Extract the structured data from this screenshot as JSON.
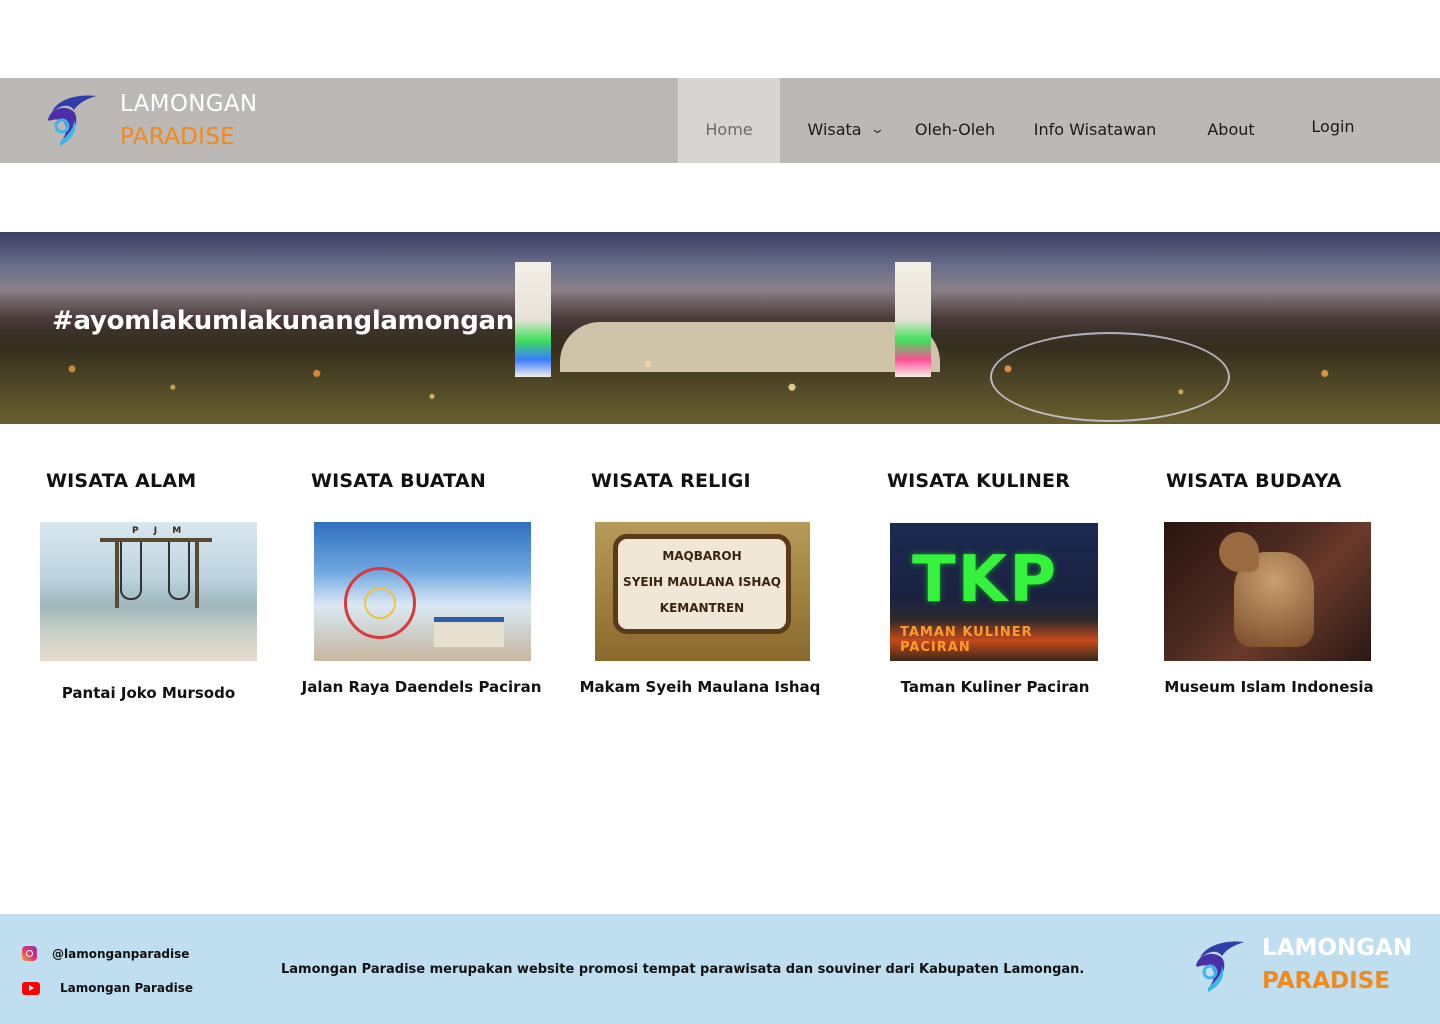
{
  "brand": {
    "line1": "LAMONGAN",
    "line2": "PARADISE"
  },
  "nav": {
    "home": "Home",
    "wisata": "Wisata",
    "oleh": "Oleh-Oleh",
    "info": "Info Wisatawan",
    "about": "About",
    "login": "Login"
  },
  "hero": {
    "tagline": "#ayomlakumlakunanglamongan"
  },
  "categories": [
    {
      "title": "WISATA ALAM",
      "caption": "Pantai Joko Mursodo"
    },
    {
      "title": "WISATA BUATAN",
      "caption": "Jalan Raya Daendels Paciran"
    },
    {
      "title": "WISATA RELIGI",
      "caption": "Makam Syeih Maulana Ishaq"
    },
    {
      "title": "WISATA KULINER",
      "caption": "Taman Kuliner Paciran"
    },
    {
      "title": "WISATA BUDAYA",
      "caption": "Museum Islam Indonesia"
    }
  ],
  "image_text": {
    "swing_sign": "P J M",
    "makam_line1": "MAQBAROH",
    "makam_line2": "SYEIH MAULANA ISHAQ",
    "makam_line3": "KEMANTREN",
    "tkp": "TKP",
    "tkp_sub": "TAMAN KULINER PACIRAN"
  },
  "footer": {
    "instagram": "@lamonganparadise",
    "youtube": "Lamongan Paradise",
    "description": "Lamongan Paradise merupakan website promosi tempat parawisata dan souviner dari Kabupaten Lamongan."
  },
  "colors": {
    "header_bg": "#bcb8b5",
    "accent_orange": "#f08a1c",
    "footer_bg": "#bfdff0",
    "logo_blue": "#2f3ea8",
    "logo_cyan": "#3fb6e8"
  },
  "icons": [
    "logo-fish-icon",
    "chevron-down-icon",
    "instagram-icon",
    "youtube-icon"
  ]
}
